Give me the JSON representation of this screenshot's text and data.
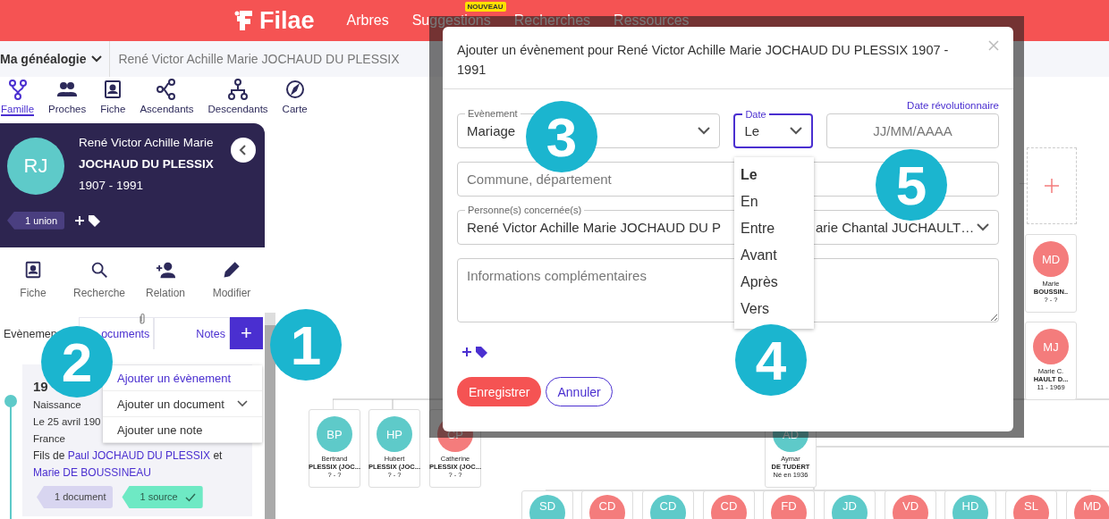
{
  "header": {
    "logo": "Filae",
    "nav": [
      {
        "label": "Arbres"
      },
      {
        "label": "Suggestions",
        "badge": "NOUVEAU"
      },
      {
        "label": "Recherches"
      },
      {
        "label": "Ressources"
      }
    ]
  },
  "breadcrumb": {
    "tree": "Ma généalogie",
    "person": "René Victor Achille Marie JOCHAUD DU PLESSIX"
  },
  "views": [
    {
      "label": "Famille",
      "kind": "family",
      "selected": true
    },
    {
      "label": "Proches",
      "kind": "people",
      "selected": false
    },
    {
      "label": "Fiche",
      "kind": "card",
      "selected": false
    },
    {
      "label": "Ascendants",
      "kind": "ancestors",
      "selected": false
    },
    {
      "label": "Descendants",
      "kind": "descendants",
      "selected": false
    },
    {
      "label": "Carte",
      "kind": "compass",
      "selected": false
    }
  ],
  "person_card": {
    "initials": "RJ",
    "first_names": "René Victor Achille Marie",
    "last_name": "JOCHAUD DU PLESSIX",
    "dates": "1907 - 1991",
    "union_tag": "1 union"
  },
  "person_actions": [
    {
      "label": "Fiche",
      "kind": "card"
    },
    {
      "label": "Recherche",
      "kind": "search"
    },
    {
      "label": "Relation",
      "kind": "add-person"
    },
    {
      "label": "Modifier",
      "kind": "edit"
    }
  ],
  "panel_tabs": [
    {
      "label": "Evènemen",
      "selected": true,
      "attachment": false
    },
    {
      "label": "ocuments",
      "selected": false,
      "attachment": true
    },
    {
      "label": "Notes",
      "selected": false,
      "attachment": false
    }
  ],
  "add_button": "+",
  "add_menu": [
    {
      "label": "Ajouter un évènement",
      "selected": true,
      "expandable": false
    },
    {
      "label": "Ajouter un document",
      "selected": false,
      "expandable": true
    },
    {
      "label": "Ajouter une note",
      "selected": false,
      "expandable": false
    }
  ],
  "event": {
    "year": "19",
    "type": "Naissance",
    "date_line": "Le 25 avril 190",
    "place": "France",
    "parents_prefix": "Fils de",
    "father": "Paul JOCHAUD DU PLESSIX",
    "conjunction": "et",
    "mother": "Marie DE BOUSSINEAU",
    "tags": [
      {
        "label": "1 document",
        "kind": "document",
        "verified": false
      },
      {
        "label": "1 source",
        "kind": "source",
        "verified": true
      }
    ]
  },
  "tree": {
    "nodes": [
      {
        "initials": "BP",
        "first_name": "Bertrand",
        "last_name": "PLESSIX (JOC...",
        "dates": "? - ?",
        "color": "#5ecac9"
      },
      {
        "initials": "HP",
        "first_name": "Hubert",
        "last_name": "PLESSIX (JOC...",
        "dates": "? - ?",
        "color": "#5ecac9"
      },
      {
        "initials": "CP",
        "first_name": "Catherine",
        "last_name": "PLESSIX (JOC...",
        "dates": "? - ?",
        "color": "#f47c7c"
      },
      {
        "initials": "AD",
        "first_name": "Aymar",
        "last_name": "DE TUDERT",
        "dates": "Né en 1936",
        "color": "#5ecac9"
      },
      {
        "initials": "MD",
        "first_name": "Marie",
        "last_name": "BOUSSIN..",
        "dates": "? - ?",
        "color": "#f47c7c"
      },
      {
        "initials": "MJ",
        "first_name": "Marie C.",
        "last_name": "HAULT D...",
        "dates": "11 - 1969",
        "color": "#f47c7c"
      }
    ],
    "children": [
      {
        "initials": "SD",
        "color": "#5ecac9"
      },
      {
        "initials": "CD",
        "color": "#f47c7c"
      },
      {
        "initials": "CD",
        "color": "#5ecac9"
      },
      {
        "initials": "CD",
        "color": "#f47c7c"
      },
      {
        "initials": "FD",
        "color": "#f47c7c"
      },
      {
        "initials": "JD",
        "color": "#5ecac9"
      },
      {
        "initials": "VD",
        "color": "#f47c7c"
      },
      {
        "initials": "HD",
        "color": "#5ecac9"
      },
      {
        "initials": "SL",
        "color": "#f47c7c"
      },
      {
        "initials": "MD",
        "color": "#f47c7c"
      }
    ]
  },
  "modal": {
    "title": "Ajouter un évènement pour René Victor Achille Marie JOCHAUD DU PLESSIX 1907 - 1991",
    "revolutionary_link": "Date révolutionnaire",
    "event_field": {
      "label": "Evènement",
      "value": "Mariage"
    },
    "date_field": {
      "label": "Date",
      "value": "Le"
    },
    "date_input": {
      "placeholder": "JJ/MM/AAAA"
    },
    "place_input": {
      "placeholder": "Commune, département"
    },
    "persons_field": {
      "label": "Personne(s) concernée(s)",
      "value_start": "René Victor Achille Marie JOCHAUD DU P",
      "value_end": "arie Chantal JUCHAULT…"
    },
    "notes": {
      "placeholder": "Informations complémentaires"
    },
    "save": "Enregistrer",
    "cancel": "Annuler"
  },
  "date_options": [
    {
      "label": "Le",
      "selected": true
    },
    {
      "label": "En",
      "selected": false
    },
    {
      "label": "Entre",
      "selected": false
    },
    {
      "label": "Avant",
      "selected": false
    },
    {
      "label": "Après",
      "selected": false
    },
    {
      "label": "Vers",
      "selected": false
    }
  ],
  "callouts": [
    {
      "number": "1"
    },
    {
      "number": "2"
    },
    {
      "number": "3"
    },
    {
      "number": "4"
    },
    {
      "number": "5"
    }
  ]
}
